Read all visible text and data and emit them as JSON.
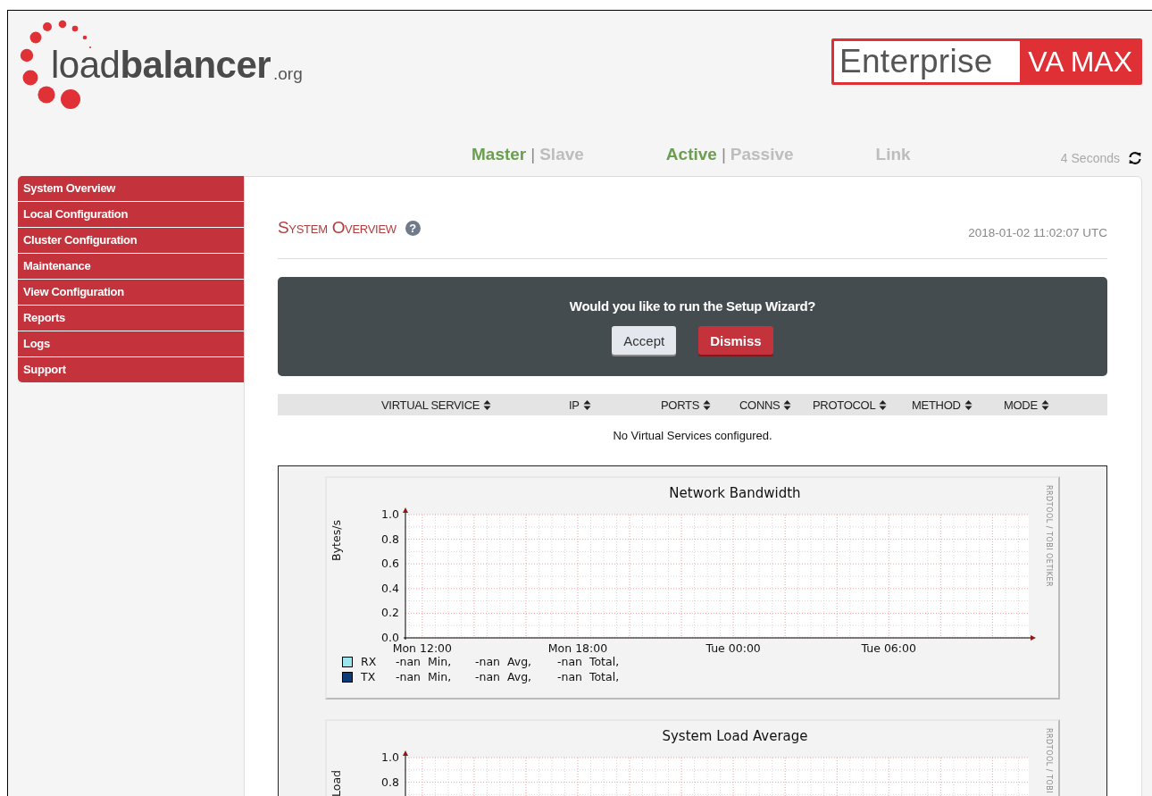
{
  "logo": {
    "wordmark": "load**balancer**",
    "suffix": ".org"
  },
  "edition_badge": {
    "edition": "Enterprise",
    "product": "VA MAX"
  },
  "status_bar": {
    "groups": [
      {
        "items": [
          {
            "label": "Master",
            "active": true
          },
          {
            "label": "Slave",
            "active": false
          }
        ],
        "separator": "|"
      },
      {
        "items": [
          {
            "label": "Active",
            "active": true
          },
          {
            "label": "Passive",
            "active": false
          }
        ],
        "separator": "|"
      },
      {
        "items": [
          {
            "label": "Link",
            "active": false
          }
        ]
      }
    ],
    "refresh": {
      "label": "4 Seconds"
    }
  },
  "sidebar": {
    "items": [
      {
        "label": "System Overview"
      },
      {
        "label": "Local Configuration"
      },
      {
        "label": "Cluster Configuration"
      },
      {
        "label": "Maintenance"
      },
      {
        "label": "View Configuration"
      },
      {
        "label": "Reports"
      },
      {
        "label": "Logs"
      },
      {
        "label": "Support"
      }
    ]
  },
  "page": {
    "title": "System Overview",
    "help": "?",
    "timestamp": "2018-01-02 11:02:07 UTC"
  },
  "wizard": {
    "question": "Would you like to run the Setup Wizard?",
    "buttons": [
      {
        "label": "Accept",
        "kind": "secondary"
      },
      {
        "label": "Dismiss",
        "kind": "danger"
      }
    ]
  },
  "table": {
    "columns": [
      {
        "label": "VIRTUAL SERVICE"
      },
      {
        "label": "IP"
      },
      {
        "label": "PORTS"
      },
      {
        "label": "CONNS"
      },
      {
        "label": "PROTOCOL"
      },
      {
        "label": "METHOD"
      },
      {
        "label": "MODE"
      }
    ],
    "empty_message": "No Virtual Services configured."
  },
  "graphs": [
    {
      "chart_data": {
        "type": "line",
        "title": "Network Bandwidth",
        "ylabel": "Bytes/s",
        "ylim": [
          0,
          1
        ],
        "grid": true,
        "categories": [
          "Mon 12:00",
          null,
          null,
          null,
          null,
          null,
          "Mon 18:00",
          null,
          null,
          null,
          null,
          null,
          "Tue 00:00",
          null,
          null,
          null,
          null,
          null,
          "Tue 06:00",
          null,
          null,
          null,
          null,
          null
        ],
        "yticks": [
          {
            "value": 0,
            "label": "0.0"
          },
          {
            "value": 0.2,
            "label": "0.2"
          },
          {
            "value": 0.4,
            "label": "0.4"
          },
          {
            "value": 0.6,
            "label": "0.6"
          },
          {
            "value": 0.8,
            "label": "0.8"
          },
          {
            "value": 1,
            "label": "1.0"
          }
        ],
        "series": [
          {
            "name": "RX",
            "color": "#99e6ee",
            "values": [
              null,
              null,
              null,
              null,
              null,
              null,
              null,
              null,
              null,
              null,
              null,
              null,
              null,
              null,
              null,
              null,
              null,
              null,
              null,
              null,
              null,
              null,
              null,
              null
            ]
          },
          {
            "name": "TX",
            "color": "#0b3c78",
            "values": [
              null,
              null,
              null,
              null,
              null,
              null,
              null,
              null,
              null,
              null,
              null,
              null,
              null,
              null,
              null,
              null,
              null,
              null,
              null,
              null,
              null,
              null,
              null,
              null
            ]
          }
        ]
      },
      "legend": [
        {
          "stats": [
            "-nan  Min,",
            "-nan  Avg,",
            "-nan  Total,"
          ]
        },
        {
          "stats": [
            "-nan  Min,",
            "-nan  Avg,",
            "-nan  Total,"
          ]
        }
      ],
      "credit": "RRDTOOL / TOBI OETIKER"
    },
    {
      "chart_data": {
        "type": "line",
        "title": "System Load Average",
        "ylabel": "Load",
        "ylim": [
          0,
          1
        ],
        "grid": true,
        "categories": [
          null,
          null,
          null,
          null,
          null,
          null,
          null,
          null,
          null,
          null,
          null,
          null,
          null,
          null,
          null,
          null,
          null,
          null,
          null,
          null,
          null,
          null,
          null,
          null
        ],
        "yticks": [
          {
            "value": 0.8,
            "label": "0.8"
          },
          {
            "value": 1,
            "label": "1.0"
          }
        ]
      },
      "credit": "RRDTOOL / TOBI"
    }
  ]
}
